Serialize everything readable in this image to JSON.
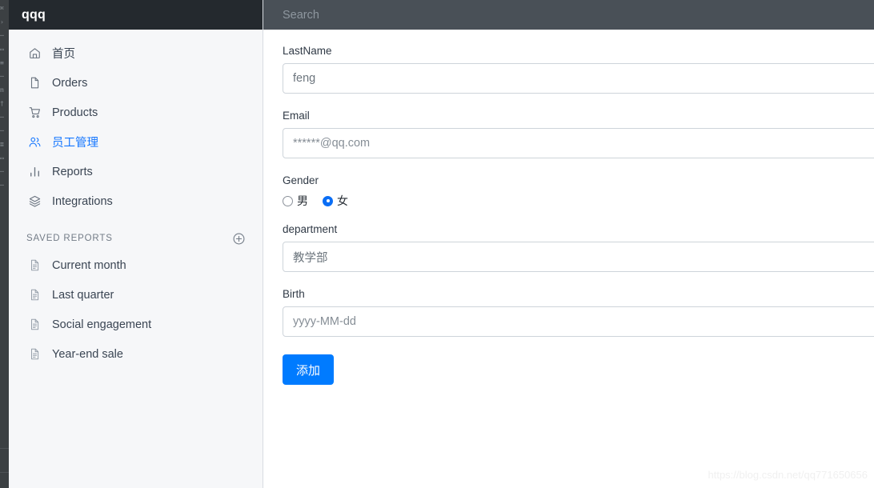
{
  "brand": {
    "title": "qqq"
  },
  "topbar": {
    "search_placeholder": "Search"
  },
  "sidebar": {
    "nav": [
      {
        "label": "首页",
        "icon": "home-icon",
        "active": false
      },
      {
        "label": "Orders",
        "icon": "file-icon",
        "active": false
      },
      {
        "label": "Products",
        "icon": "cart-icon",
        "active": false
      },
      {
        "label": "员工管理",
        "icon": "people-icon",
        "active": true
      },
      {
        "label": "Reports",
        "icon": "bar-chart-icon",
        "active": false
      },
      {
        "label": "Integrations",
        "icon": "layers-icon",
        "active": false
      }
    ],
    "saved_reports": {
      "section_title": "SAVED REPORTS",
      "add_icon": "circle-plus-icon",
      "items": [
        {
          "label": "Current month",
          "icon": "document-icon"
        },
        {
          "label": "Last quarter",
          "icon": "document-icon"
        },
        {
          "label": "Social engagement",
          "icon": "document-icon"
        },
        {
          "label": "Year-end sale",
          "icon": "document-icon"
        }
      ]
    }
  },
  "form": {
    "lastname": {
      "label": "LastName",
      "value": "feng",
      "placeholder": ""
    },
    "email": {
      "label": "Email",
      "value": "",
      "placeholder": "******@qq.com"
    },
    "gender": {
      "label": "Gender",
      "options": [
        {
          "label": "男",
          "checked": false
        },
        {
          "label": "女",
          "checked": true
        }
      ]
    },
    "department": {
      "label": "department",
      "value": "教学部",
      "placeholder": ""
    },
    "birth": {
      "label": "Birth",
      "value": "",
      "placeholder": "yyyy-MM-dd"
    },
    "submit_label": "添加"
  },
  "watermark": {
    "text": "https://blog.csdn.net/qq771650656"
  },
  "edge_strip": {
    "rows": [
      "⌘",
      "›",
      "─",
      "▭",
      "≡",
      "─",
      "m",
      "†",
      "─",
      "─",
      "≣",
      "▭",
      "─",
      "─"
    ]
  },
  "colors": {
    "accent": "#1677ff",
    "button": "#007bff",
    "sidebar_bg": "#f6f7f9",
    "header_bg": "#24292e",
    "topbar_bg": "#495057"
  }
}
